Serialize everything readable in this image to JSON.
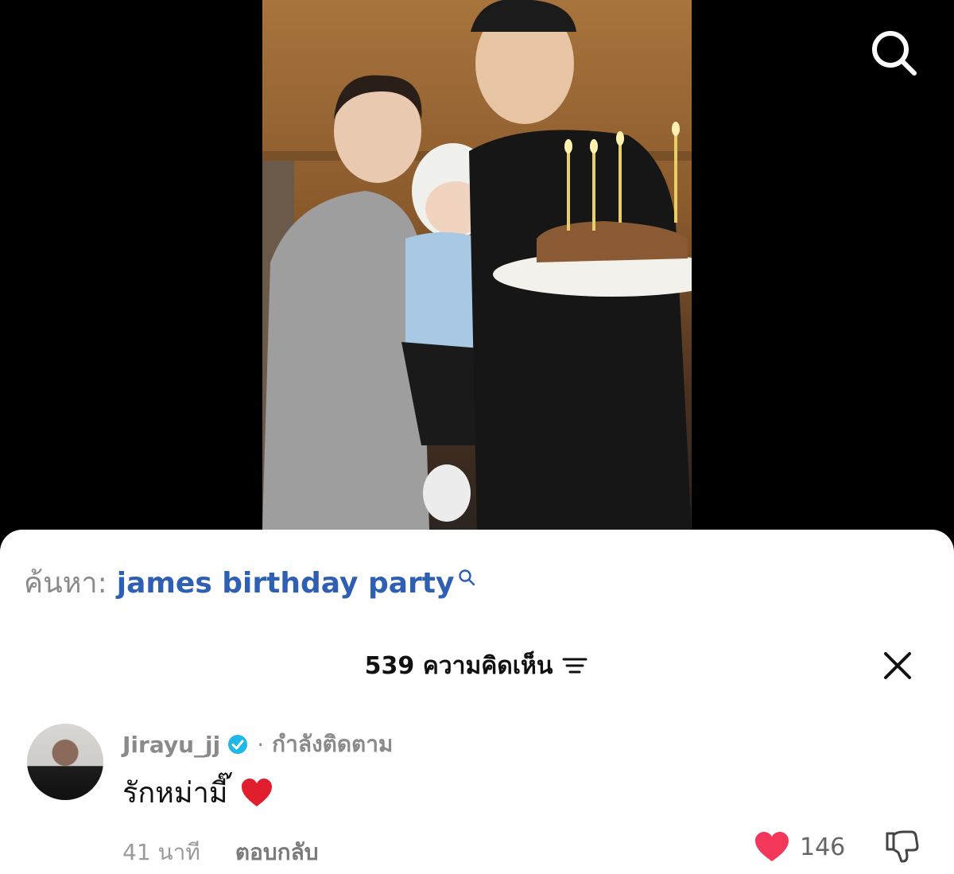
{
  "search_suggestion": {
    "prefix": "ค้นหา:",
    "query": "james birthday party"
  },
  "comments_header": {
    "title": "539 ความคิดเห็น"
  },
  "comment": {
    "username": "Jirayu_jj",
    "separator": "·",
    "follow_status": "กำลังติดตาม",
    "text": "รักหม่ามี๊",
    "time": "41 นาที",
    "reply_label": "ตอบกลับ",
    "like_count": "146"
  },
  "colors": {
    "accent_link": "#2f5fb3",
    "like_red": "#f2375a",
    "verified_blue": "#20b8e8"
  },
  "icons": {
    "top_right": "search-icon",
    "header_sort": "sort-icon",
    "header_close": "close-icon",
    "verified": "verified-badge-icon",
    "like": "heart-icon",
    "dislike": "thumbs-down-icon"
  }
}
